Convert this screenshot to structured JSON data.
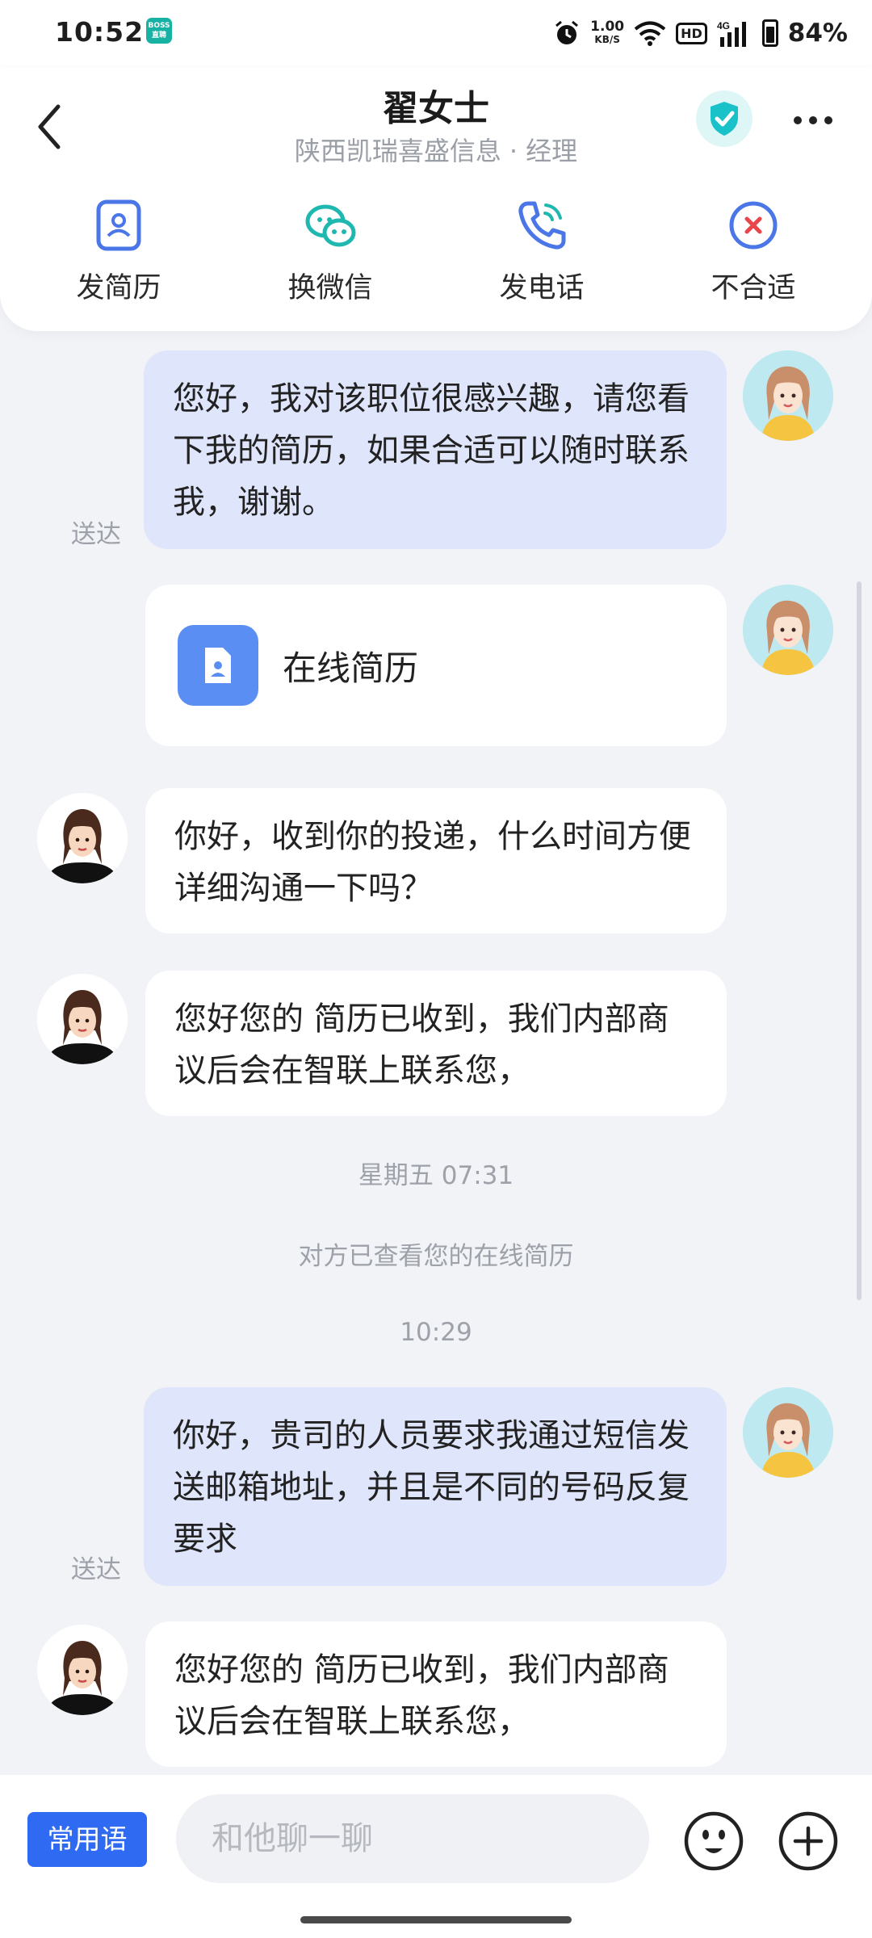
{
  "status_bar": {
    "time": "10:52",
    "app_icon_text": "BOSS直聘",
    "net_rate_top": "1.00",
    "net_rate_bottom": "KB/S",
    "hd_label": "HD",
    "signal_label": "4G",
    "battery": "84%"
  },
  "header": {
    "title": "翟女士",
    "company": "陕西凯瑞喜盛信息",
    "separator": "·",
    "position": "经理",
    "verified_color": "#19c2c9"
  },
  "actions": [
    {
      "label": "发简历",
      "icon": "resume-icon"
    },
    {
      "label": "换微信",
      "icon": "wechat-icon"
    },
    {
      "label": "发电话",
      "icon": "phone-icon"
    },
    {
      "label": "不合适",
      "icon": "not-suitable-icon"
    }
  ],
  "messages": [
    {
      "from": "me",
      "text": "您好，我对该职位很感兴趣，请您看下我的简历，如果合适可以随时联系我，谢谢。",
      "status": "送达"
    },
    {
      "from": "me",
      "type": "resume",
      "text": "在线简历"
    },
    {
      "from": "hr",
      "text": "你好，收到你的投递，什么时间方便详细沟通一下吗？"
    },
    {
      "from": "hr",
      "text": "您好您的 简历已收到，我们内部商议后会在智联上联系您，"
    },
    {
      "type": "time",
      "text": "星期五 07:31"
    },
    {
      "type": "system",
      "text": "对方已查看您的在线简历"
    },
    {
      "type": "time",
      "text": "10:29"
    },
    {
      "from": "me",
      "text": "你好，贵司的人员要求我通过短信发送邮箱地址，并且是不同的号码反复要求",
      "status": "送达"
    },
    {
      "from": "hr",
      "text": "您好您的 简历已收到，我们内部商议后会在智联上联系您，"
    }
  ],
  "input_bar": {
    "phrases_label": "常用语",
    "placeholder": "和他聊一聊",
    "accent_color": "#2f6bf2"
  }
}
